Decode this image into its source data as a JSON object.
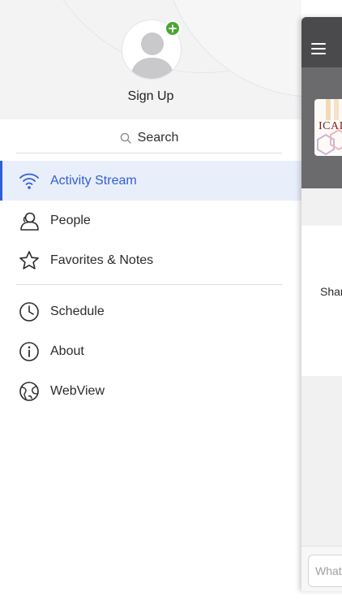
{
  "drawer": {
    "signup_label": "Sign Up",
    "search_label": "Search",
    "menu": [
      {
        "id": "activity-stream",
        "label": "Activity Stream",
        "icon": "wifi-icon",
        "active": true
      },
      {
        "id": "people",
        "label": "People",
        "icon": "person-icon",
        "active": false
      },
      {
        "id": "favorites-notes",
        "label": "Favorites & Notes",
        "icon": "star-icon",
        "active": false
      },
      {
        "id": "schedule",
        "label": "Schedule",
        "icon": "clock-icon",
        "active": false
      },
      {
        "id": "about",
        "label": "About",
        "icon": "info-icon",
        "active": false
      },
      {
        "id": "webview",
        "label": "WebView",
        "icon": "globe-icon",
        "active": false
      }
    ]
  },
  "preview": {
    "logo_text": "ICAI",
    "share_text": "Shar",
    "input_placeholder": "What"
  },
  "colors": {
    "accent": "#2e5fd8",
    "active_bg": "#e9eefb",
    "add_badge": "#4aa634",
    "header_bg": "#f3f3f4",
    "topbar": "#4a4a4c"
  }
}
